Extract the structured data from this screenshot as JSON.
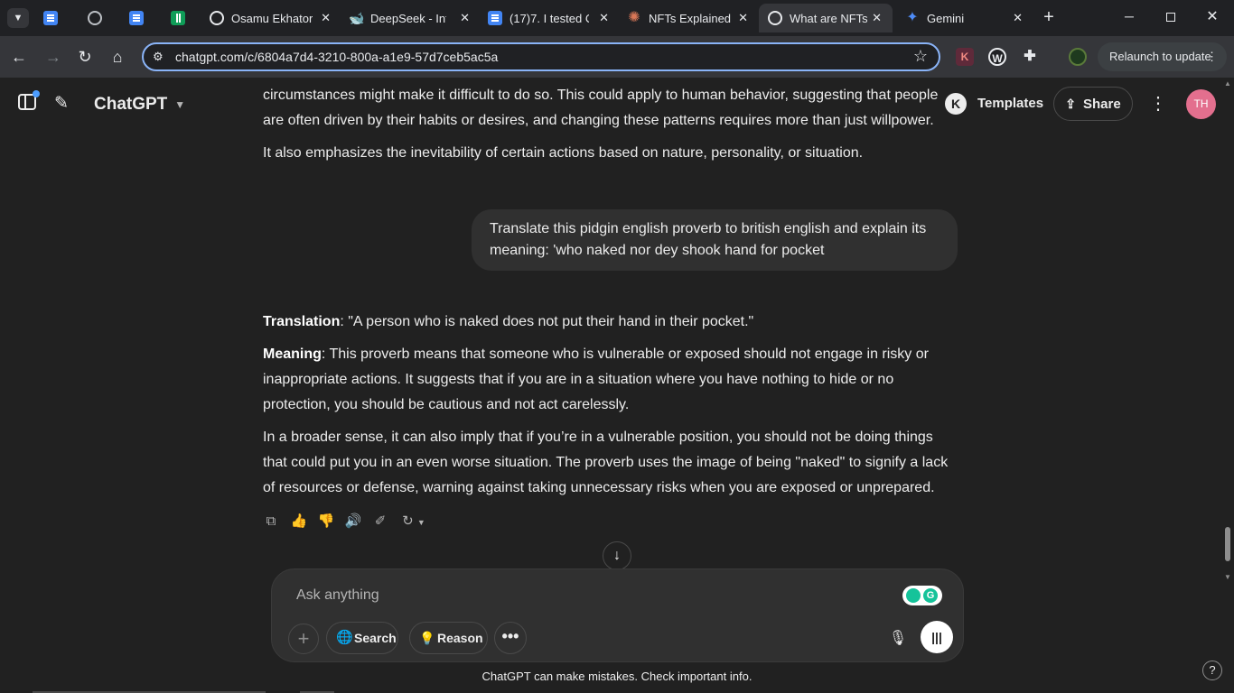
{
  "browser": {
    "tabs": [
      {
        "title": "",
        "icon": "google-docs-icon",
        "active": false
      },
      {
        "title": "",
        "icon": "globe-icon",
        "active": false
      },
      {
        "title": "",
        "icon": "google-docs-icon",
        "active": false
      },
      {
        "title": "",
        "icon": "google-sheets-icon",
        "active": false
      },
      {
        "title": "Osamu Ekhator",
        "icon": "chatgpt-icon",
        "active": false
      },
      {
        "title": "DeepSeek - Into",
        "icon": "deepseek-icon",
        "active": false
      },
      {
        "title": "(17)7. I tested C",
        "icon": "google-docs-icon",
        "active": false
      },
      {
        "title": "NFTs Explained",
        "icon": "claude-icon",
        "active": false
      },
      {
        "title": "What are NFTs",
        "icon": "chatgpt-icon",
        "active": true
      },
      {
        "title": "Gemini",
        "icon": "gemini-icon",
        "active": false
      }
    ],
    "close_glyph": "✕",
    "new_tab_glyph": "+",
    "url": "chatgpt.com/c/6804a7d4-3210-800a-a1e9-57d7ceb5ac5a",
    "relaunch_label": "Relaunch to update",
    "accent_color": "#8ab4f8"
  },
  "header": {
    "app_title": "ChatGPT",
    "templates_label": "Templates",
    "share_label": "Share",
    "avatar_initials": "TH",
    "avatar_color": "#e36f8e",
    "k_badge": "K"
  },
  "conversation": {
    "prev_reply_lines": [
      "circumstances might make it difficult to do so. This could apply to human behavior, suggesting that people",
      "are often driven by their habits or desires, and changing these patterns requires more than just willpower.",
      "It also emphasizes the inevitability of certain actions based on nature, personality, or situation."
    ],
    "user_message_lines": [
      "Translate this pidgin english proverb to british english and explain its",
      "meaning: 'who naked nor dey shook hand for pocket"
    ],
    "reply": {
      "translation_label": "Translation",
      "translation_text": ": \"A person who is naked does not put their hand in their pocket.\"",
      "meaning_label": "Meaning",
      "meaning_lines": [
        ": This proverb means that someone who is vulnerable or exposed should not engage in risky or",
        "inappropriate actions. It suggests that if you are in a situation where you have nothing to hide or no",
        "protection, you should be cautious and not act carelessly."
      ],
      "broader_lines": [
        "In a broader sense, it can also imply that if you’re in a vulnerable position, you should not be doing things",
        "that could put you in an even worse situation. The proverb uses the image of being \"naked\" to signify a lack",
        "of resources or defense, warning against taking unnecessary risks when you are exposed or unprepared."
      ]
    }
  },
  "composer": {
    "placeholder": "Ask anything",
    "search_label": "Search",
    "reason_label": "Reason"
  },
  "footer": {
    "disclaimer": "ChatGPT can make mistakes. Check important info.",
    "help_glyph": "?"
  }
}
